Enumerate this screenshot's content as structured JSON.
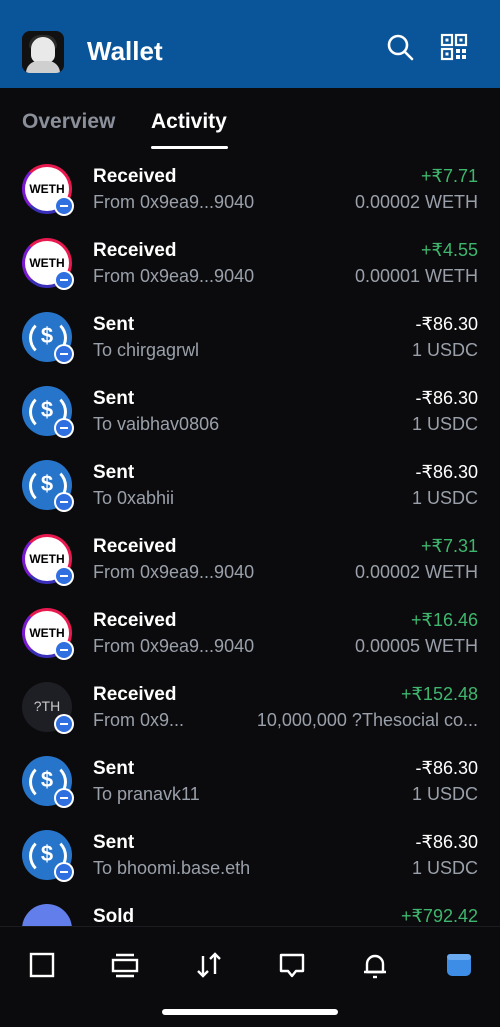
{
  "header": {
    "title": "Wallet",
    "avatar": "profile-avatar",
    "icons": [
      "search-icon",
      "qr-code-icon"
    ]
  },
  "tabs": [
    {
      "label": "Overview",
      "active": false
    },
    {
      "label": "Activity",
      "active": true
    }
  ],
  "activity": [
    {
      "icon": "weth-token-icon",
      "icon_text": "WETH",
      "title": "Received",
      "subtitle": "From 0x9ea9...9040",
      "amount": "+₹7.71",
      "token_amount": "0.00002 WETH",
      "positive": true
    },
    {
      "icon": "weth-token-icon",
      "icon_text": "WETH",
      "title": "Received",
      "subtitle": "From 0x9ea9...9040",
      "amount": "+₹4.55",
      "token_amount": "0.00001 WETH",
      "positive": true
    },
    {
      "icon": "usdc-token-icon",
      "icon_text": "$",
      "title": "Sent",
      "subtitle": "To chirgagrwl",
      "amount": "-₹86.30",
      "token_amount": "1 USDC",
      "positive": false
    },
    {
      "icon": "usdc-token-icon",
      "icon_text": "$",
      "title": "Sent",
      "subtitle": "To vaibhav0806",
      "amount": "-₹86.30",
      "token_amount": "1 USDC",
      "positive": false
    },
    {
      "icon": "usdc-token-icon",
      "icon_text": "$",
      "title": "Sent",
      "subtitle": "To 0xabhii",
      "amount": "-₹86.30",
      "token_amount": "1 USDC",
      "positive": false
    },
    {
      "icon": "weth-token-icon",
      "icon_text": "WETH",
      "title": "Received",
      "subtitle": "From 0x9ea9...9040",
      "amount": "+₹7.31",
      "token_amount": "0.00002 WETH",
      "positive": true
    },
    {
      "icon": "weth-token-icon",
      "icon_text": "WETH",
      "title": "Received",
      "subtitle": "From 0x9ea9...9040",
      "amount": "+₹16.46",
      "token_amount": "0.00005 WETH",
      "positive": true
    },
    {
      "icon": "unknown-token-icon",
      "icon_text": "?TH",
      "title": "Received",
      "subtitle": "From 0x9...",
      "amount": "+₹152.48",
      "token_amount": "10,000,000 ?Thesocial co...",
      "positive": true
    },
    {
      "icon": "usdc-token-icon",
      "icon_text": "$",
      "title": "Sent",
      "subtitle": "To pranavk11",
      "amount": "-₹86.30",
      "token_amount": "1 USDC",
      "positive": false
    },
    {
      "icon": "usdc-token-icon",
      "icon_text": "$",
      "title": "Sent",
      "subtitle": "To bhoomi.base.eth",
      "amount": "-₹86.30",
      "token_amount": "1 USDC",
      "positive": false
    },
    {
      "icon": "eth-token-icon",
      "icon_text": "",
      "title": "Sold",
      "subtitle": "",
      "amount": "+₹792.42",
      "token_amount": "",
      "positive": true
    }
  ],
  "bottom_nav": [
    "home-icon",
    "browser-icon",
    "swap-icon",
    "messages-icon",
    "notifications-icon",
    "wallet-icon"
  ],
  "colors": {
    "header_bg": "#0a5499",
    "positive": "#3fb66e",
    "active_nav": "#3d8de6"
  }
}
